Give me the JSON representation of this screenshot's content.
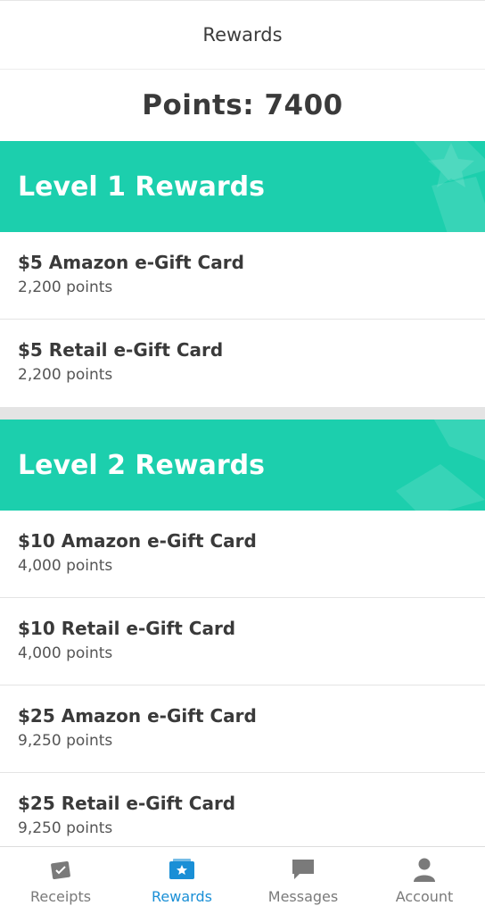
{
  "header": {
    "title": "Rewards"
  },
  "points": {
    "label": "Points: 7400"
  },
  "levels": [
    {
      "title": "Level 1 Rewards",
      "items": [
        {
          "name": "$5 Amazon e-Gift Card",
          "points": "2,200 points"
        },
        {
          "name": "$5 Retail e-Gift Card",
          "points": "2,200 points"
        }
      ]
    },
    {
      "title": "Level 2 Rewards",
      "items": [
        {
          "name": "$10 Amazon e-Gift Card",
          "points": "4,000 points"
        },
        {
          "name": "$10 Retail e-Gift Card",
          "points": "4,000 points"
        },
        {
          "name": "$25 Amazon e-Gift Card",
          "points": "9,250 points"
        },
        {
          "name": "$25 Retail e-Gift Card",
          "points": "9,250 points"
        }
      ]
    }
  ],
  "tabs": [
    {
      "label": "Receipts",
      "icon": "receipt-icon",
      "active": false
    },
    {
      "label": "Rewards",
      "icon": "rewards-icon",
      "active": true
    },
    {
      "label": "Messages",
      "icon": "message-icon",
      "active": false
    },
    {
      "label": "Account",
      "icon": "account-icon",
      "active": false
    }
  ],
  "colors": {
    "accent": "#1ccfad",
    "active_tab": "#1a8fd6",
    "inactive_tab": "#7a7a7a",
    "divider": "#e4e4e4"
  }
}
